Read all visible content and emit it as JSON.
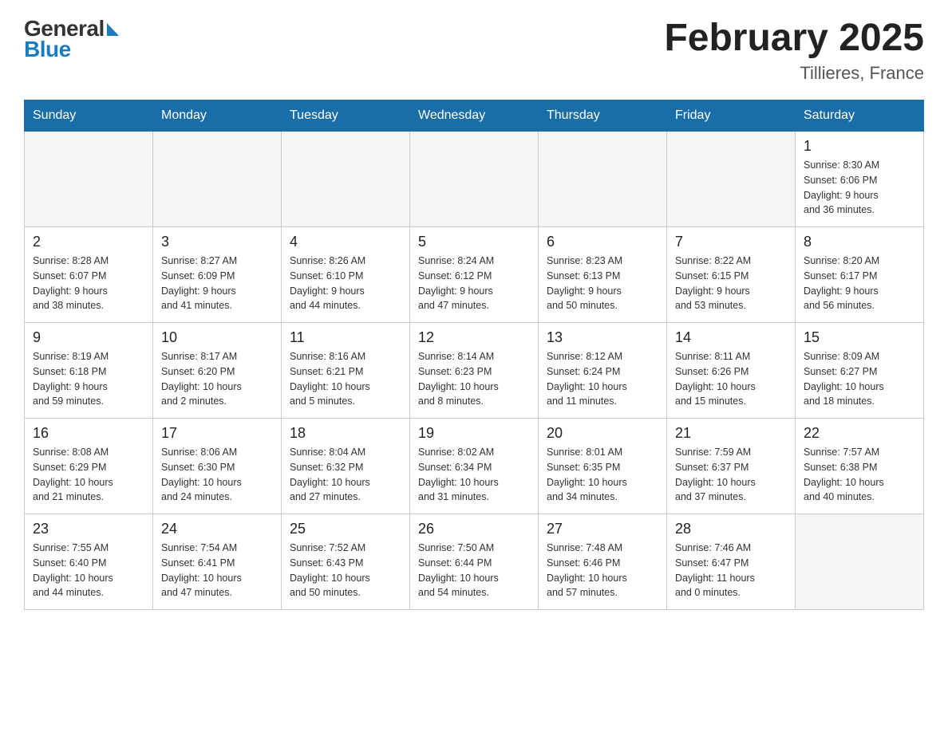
{
  "header": {
    "title": "February 2025",
    "subtitle": "Tillieres, France",
    "logo_general": "General",
    "logo_blue": "Blue"
  },
  "days_of_week": [
    "Sunday",
    "Monday",
    "Tuesday",
    "Wednesday",
    "Thursday",
    "Friday",
    "Saturday"
  ],
  "weeks": [
    {
      "days": [
        {
          "number": "",
          "info": ""
        },
        {
          "number": "",
          "info": ""
        },
        {
          "number": "",
          "info": ""
        },
        {
          "number": "",
          "info": ""
        },
        {
          "number": "",
          "info": ""
        },
        {
          "number": "",
          "info": ""
        },
        {
          "number": "1",
          "info": "Sunrise: 8:30 AM\nSunset: 6:06 PM\nDaylight: 9 hours\nand 36 minutes."
        }
      ]
    },
    {
      "days": [
        {
          "number": "2",
          "info": "Sunrise: 8:28 AM\nSunset: 6:07 PM\nDaylight: 9 hours\nand 38 minutes."
        },
        {
          "number": "3",
          "info": "Sunrise: 8:27 AM\nSunset: 6:09 PM\nDaylight: 9 hours\nand 41 minutes."
        },
        {
          "number": "4",
          "info": "Sunrise: 8:26 AM\nSunset: 6:10 PM\nDaylight: 9 hours\nand 44 minutes."
        },
        {
          "number": "5",
          "info": "Sunrise: 8:24 AM\nSunset: 6:12 PM\nDaylight: 9 hours\nand 47 minutes."
        },
        {
          "number": "6",
          "info": "Sunrise: 8:23 AM\nSunset: 6:13 PM\nDaylight: 9 hours\nand 50 minutes."
        },
        {
          "number": "7",
          "info": "Sunrise: 8:22 AM\nSunset: 6:15 PM\nDaylight: 9 hours\nand 53 minutes."
        },
        {
          "number": "8",
          "info": "Sunrise: 8:20 AM\nSunset: 6:17 PM\nDaylight: 9 hours\nand 56 minutes."
        }
      ]
    },
    {
      "days": [
        {
          "number": "9",
          "info": "Sunrise: 8:19 AM\nSunset: 6:18 PM\nDaylight: 9 hours\nand 59 minutes."
        },
        {
          "number": "10",
          "info": "Sunrise: 8:17 AM\nSunset: 6:20 PM\nDaylight: 10 hours\nand 2 minutes."
        },
        {
          "number": "11",
          "info": "Sunrise: 8:16 AM\nSunset: 6:21 PM\nDaylight: 10 hours\nand 5 minutes."
        },
        {
          "number": "12",
          "info": "Sunrise: 8:14 AM\nSunset: 6:23 PM\nDaylight: 10 hours\nand 8 minutes."
        },
        {
          "number": "13",
          "info": "Sunrise: 8:12 AM\nSunset: 6:24 PM\nDaylight: 10 hours\nand 11 minutes."
        },
        {
          "number": "14",
          "info": "Sunrise: 8:11 AM\nSunset: 6:26 PM\nDaylight: 10 hours\nand 15 minutes."
        },
        {
          "number": "15",
          "info": "Sunrise: 8:09 AM\nSunset: 6:27 PM\nDaylight: 10 hours\nand 18 minutes."
        }
      ]
    },
    {
      "days": [
        {
          "number": "16",
          "info": "Sunrise: 8:08 AM\nSunset: 6:29 PM\nDaylight: 10 hours\nand 21 minutes."
        },
        {
          "number": "17",
          "info": "Sunrise: 8:06 AM\nSunset: 6:30 PM\nDaylight: 10 hours\nand 24 minutes."
        },
        {
          "number": "18",
          "info": "Sunrise: 8:04 AM\nSunset: 6:32 PM\nDaylight: 10 hours\nand 27 minutes."
        },
        {
          "number": "19",
          "info": "Sunrise: 8:02 AM\nSunset: 6:34 PM\nDaylight: 10 hours\nand 31 minutes."
        },
        {
          "number": "20",
          "info": "Sunrise: 8:01 AM\nSunset: 6:35 PM\nDaylight: 10 hours\nand 34 minutes."
        },
        {
          "number": "21",
          "info": "Sunrise: 7:59 AM\nSunset: 6:37 PM\nDaylight: 10 hours\nand 37 minutes."
        },
        {
          "number": "22",
          "info": "Sunrise: 7:57 AM\nSunset: 6:38 PM\nDaylight: 10 hours\nand 40 minutes."
        }
      ]
    },
    {
      "days": [
        {
          "number": "23",
          "info": "Sunrise: 7:55 AM\nSunset: 6:40 PM\nDaylight: 10 hours\nand 44 minutes."
        },
        {
          "number": "24",
          "info": "Sunrise: 7:54 AM\nSunset: 6:41 PM\nDaylight: 10 hours\nand 47 minutes."
        },
        {
          "number": "25",
          "info": "Sunrise: 7:52 AM\nSunset: 6:43 PM\nDaylight: 10 hours\nand 50 minutes."
        },
        {
          "number": "26",
          "info": "Sunrise: 7:50 AM\nSunset: 6:44 PM\nDaylight: 10 hours\nand 54 minutes."
        },
        {
          "number": "27",
          "info": "Sunrise: 7:48 AM\nSunset: 6:46 PM\nDaylight: 10 hours\nand 57 minutes."
        },
        {
          "number": "28",
          "info": "Sunrise: 7:46 AM\nSunset: 6:47 PM\nDaylight: 11 hours\nand 0 minutes."
        },
        {
          "number": "",
          "info": ""
        }
      ]
    }
  ]
}
